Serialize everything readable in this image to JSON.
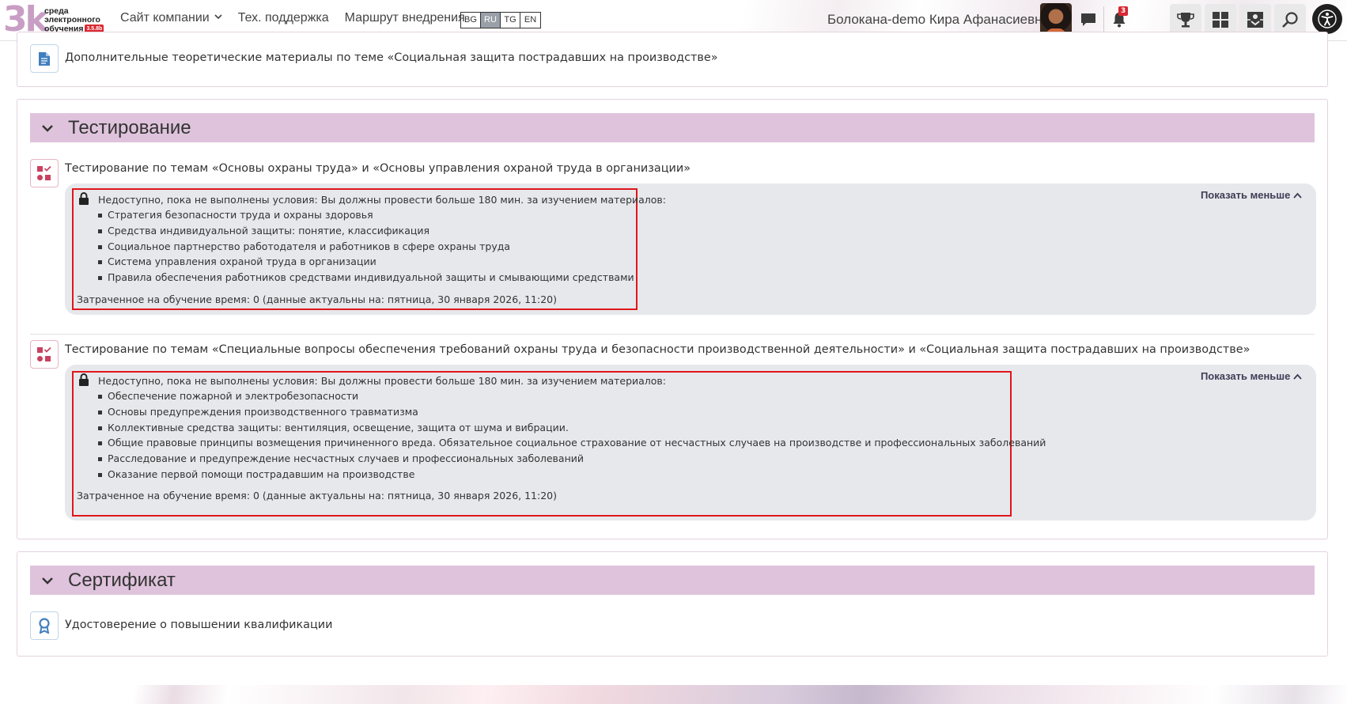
{
  "logo": {
    "mark": "3k",
    "line1": "среда",
    "line2": "электронного",
    "line3": "обучения",
    "version": "3.5.8b"
  },
  "nav": {
    "company_site": "Сайт компании",
    "support": "Тех. поддержка",
    "route": "Маршрут внедрения"
  },
  "languages": [
    "BG",
    "RU",
    "TG",
    "EN"
  ],
  "active_language": "RU",
  "user": {
    "name": "Болокана-demo Кира Афанасиевна",
    "notifications_count": "3"
  },
  "top_section": {
    "item_title": "Дополнительные теоретические материалы по теме «Социальная защита пострадавших на производстве»"
  },
  "testing_section": {
    "title": "Тестирование",
    "items": [
      {
        "title": "Тестирование по темам «Основы охраны труда» и «Основы управления охраной труда в организации»",
        "condition": "Недоступно, пока не выполнены условия: Вы должны провести больше 180 мин. за изучением материалов:",
        "materials": [
          "Стратегия безопасности труда и охраны здоровья",
          "Средства индивидуальной защиты: понятие, классификация",
          "Социальное партнерство работодателя и работников в сфере охраны труда",
          "Система управления охраной труда в организации",
          "Правила обеспечения работников средствами индивидуальной защиты и смывающими средствами"
        ],
        "spent": "Затраченное на обучение время: 0 (данные актуальны на: пятница, 30 января 2026, 11:20)",
        "show_less": "Показать меньше"
      },
      {
        "title": "Тестирование по темам «Специальные вопросы обеспечения требований охраны труда и безопасности производственной деятельности» и «Социальная защита пострадавших на производстве»",
        "condition": "Недоступно, пока не выполнены условия: Вы должны провести больше 180 мин. за изучением материалов:",
        "materials": [
          "Обеспечение пожарной и электробезопасности",
          "Основы предупреждения производственного травматизма",
          "Коллективные средства защиты: вентиляция, освещение, защита от шума и вибрации.",
          "Общие правовые принципы возмещения причиненного вреда. Обязательное социальное страхование от несчастных случаев на производстве и профессиональных заболеваний",
          "Расследование и предупреждение несчастных случаев и профессиональных заболеваний",
          "Оказание первой помощи пострадавшим на производстве"
        ],
        "spent": "Затраченное на обучение время: 0 (данные актуальны на: пятница, 30 января 2026, 11:20)",
        "show_less": "Показать меньше"
      }
    ]
  },
  "certificate_section": {
    "title": "Сертификат",
    "item_title": "Удостоверение о повышении квалификации"
  },
  "icons": {
    "dropdown": "chevron-down-icon",
    "messages": "chat-bubble-icon",
    "notifications": "bell-icon",
    "achievements": "trophy-icon",
    "dashboard": "grid-icon",
    "courses": "puzzle-icon",
    "search": "search-icon",
    "accessibility": "accessibility-icon",
    "page": "document-icon",
    "quiz": "quiz-icon",
    "certificate": "award-icon",
    "lock": "lock-icon"
  },
  "colors": {
    "section_header": "#dfc3dc",
    "restriction_bg": "#e6e8ec",
    "highlight_frame": "#e0161b",
    "badge": "#d9262f"
  }
}
